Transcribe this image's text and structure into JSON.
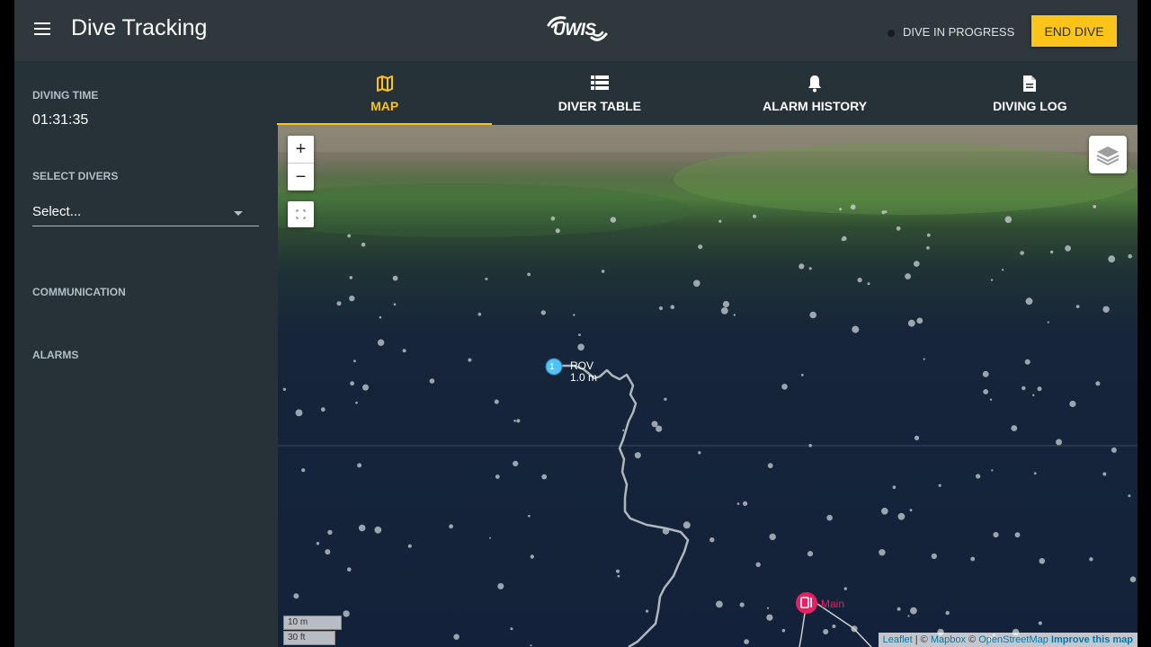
{
  "header": {
    "title": "Dive Tracking",
    "logo_text": "UWIS",
    "status_text": "DIVE IN PROGRESS",
    "end_dive_label": "END DIVE"
  },
  "sidebar": {
    "diving_time_label": "DIVING TIME",
    "diving_time_value": "01:31:35",
    "select_divers_label": "SELECT DIVERS",
    "select_placeholder": "Select...",
    "communication_label": "COMMUNICATION",
    "alarms_label": "ALARMS"
  },
  "tabs": [
    {
      "label": "MAP",
      "icon": "map-icon",
      "active": true
    },
    {
      "label": "DIVER TABLE",
      "icon": "table-icon",
      "active": false
    },
    {
      "label": "ALARM HISTORY",
      "icon": "bell-icon",
      "active": false
    },
    {
      "label": "DIVING LOG",
      "icon": "document-icon",
      "active": false
    }
  ],
  "map": {
    "zoom_in": "+",
    "zoom_out": "−",
    "rov_marker": {
      "number": "1",
      "name": "ROV",
      "depth": "1.0 m"
    },
    "main_marker": {
      "name": "Main"
    },
    "scale_metric": "10 m",
    "scale_imperial": "30 ft",
    "attribution": {
      "leaflet": "Leaflet",
      "sep1": " | © ",
      "mapbox": "Mapbox",
      "sep2": " © ",
      "osm": "OpenStreetMap",
      "improve": "Improve this map"
    }
  },
  "colors": {
    "accent": "#fcc419",
    "background": "#263238",
    "header": "#2f383d",
    "rov_marker": "#4fc3f7",
    "main_marker": "#e91e63"
  }
}
